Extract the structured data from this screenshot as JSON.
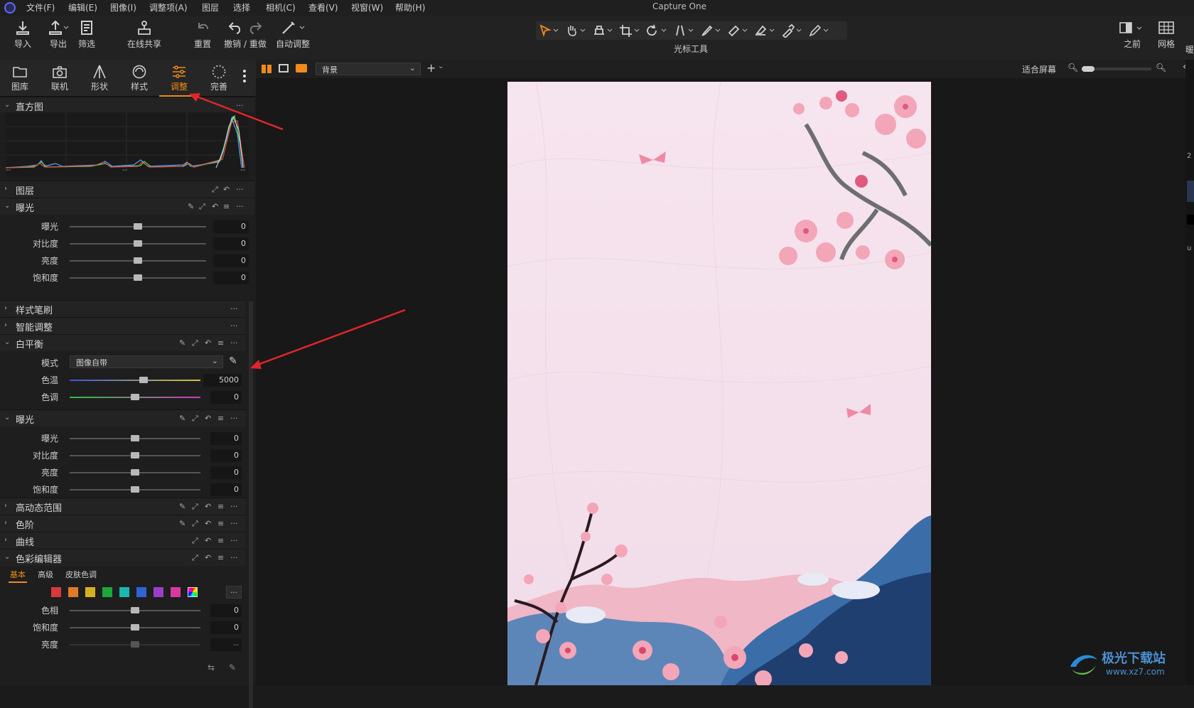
{
  "app_title": "Capture One",
  "menu": [
    "文件(F)",
    "编辑(E)",
    "图像(I)",
    "调整项(A)",
    "图层",
    "选择",
    "相机(C)",
    "查看(V)",
    "视窗(W)",
    "帮助(H)"
  ],
  "toolbar": {
    "import": "导入",
    "export": "导出",
    "filter": "筛选",
    "share": "在线共享",
    "reset": "重置",
    "undo_redo": "撤销 / 重做",
    "auto": "自动调整",
    "cursor_tools": "光标工具",
    "before": "之前",
    "grid": "网格"
  },
  "tabs": [
    "图库",
    "联机",
    "形状",
    "样式",
    "调整",
    "完善"
  ],
  "active_tab": "调整",
  "sections": {
    "histogram": "直方图",
    "hist_left": "--",
    "hist_mid": "--",
    "hist_right": "--",
    "layers": "图层",
    "exposure1": "曝光",
    "style_brush": "样式笔刷",
    "smart_adjust": "智能调整",
    "white_balance": "白平衡",
    "exposure2": "曝光",
    "hdr": "高动态范围",
    "levels": "色阶",
    "curves": "曲线",
    "color_editor": "色彩编辑器"
  },
  "exposure1": [
    {
      "label": "曝光",
      "value": "0",
      "level": 0.5
    },
    {
      "label": "对比度",
      "value": "0",
      "level": 0.5
    },
    {
      "label": "亮度",
      "value": "0",
      "level": 0.5
    },
    {
      "label": "饱和度",
      "value": "0",
      "level": 0.5
    }
  ],
  "white_balance": {
    "mode_label": "模式",
    "mode_value": "图像自带",
    "temp_label": "色温",
    "temp_value": "5000",
    "tint_label": "色调",
    "tint_value": "0"
  },
  "exposure2": [
    {
      "label": "曝光",
      "value": "0"
    },
    {
      "label": "对比度",
      "value": "0"
    },
    {
      "label": "亮度",
      "value": "0"
    },
    {
      "label": "饱和度",
      "value": "0"
    }
  ],
  "color_editor": {
    "tabs": [
      "基本",
      "高级",
      "皮肤色调"
    ],
    "swatches": [
      "#d63a3a",
      "#e07a27",
      "#d4b21f",
      "#1aa83a",
      "#18b8b0",
      "#2f63d6",
      "#9b3dc8",
      "#d63aa0"
    ],
    "more": "...",
    "hue_label": "色相",
    "hue_value": "0",
    "sat_label": "饱和度",
    "sat_value": "0",
    "light_label": "亮度",
    "light_value": "--"
  },
  "viewer": {
    "variant": "背景",
    "fit": "适合屏幕"
  },
  "right_edge": {
    "char1": "暖",
    "char2": "2",
    "char3": "u"
  },
  "watermark": {
    "cn": "极光下载站",
    "url": "www.xz7.com"
  }
}
